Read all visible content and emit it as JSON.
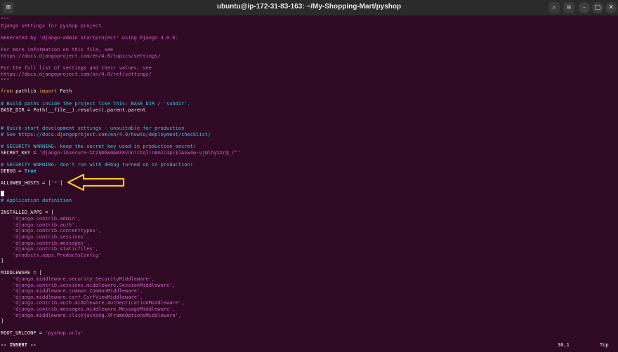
{
  "window": {
    "title": "ubuntu@ip-172-31-83-163: ~/My-Shopping-Mart/pyshop",
    "new_tab_icon": "new-tab-icon",
    "buttons": {
      "search_icon": "search-icon",
      "menu_icon": "hamburger-menu-icon",
      "minimize": "–",
      "maximize": "□",
      "close": "✕"
    }
  },
  "code": {
    "l1": "\"\"\"",
    "l2": "Django settings for pyshop project.",
    "l4": "Generated by 'django-admin startproject' using Django 4.0.6.",
    "l6": "For more information on this file, see",
    "l7": "https://docs.djangoproject.com/en/4.0/topics/settings/",
    "l9": "For the full list of settings and their values, see",
    "l10": "https://docs.djangoproject.com/en/4.0/ref/settings/",
    "l11": "\"\"\"",
    "l13_kw1": "from",
    "l13_mod": " pathlib ",
    "l13_kw2": "import",
    "l13_name": " Path",
    "l15": "# Build paths inside the project like this: BASE_DIR / 'subdir'.",
    "l16": "BASE_DIR = Path(__file__).resolve().parent.parent",
    "l19": "# Quick-start development settings - unsuitable for production",
    "l20": "# See https://docs.djangoproject.com/en/4.0/howto/deployment/checklist/",
    "l22": "# SECURITY WARNING: keep the secret key used in production secret!",
    "l23_name": "SECRET_KEY = ",
    "l23_str": "'django-insecure-%t2$m6&0&033vnn!=tql!n0mzc4p($)&vw4w-vjmlhy%2r@_r^'",
    "l25": "# SECURITY WARNING: don't run with debug turned on in production!",
    "l26_name": "DEBUG = ",
    "l26_val": "True",
    "l28_name": "ALLOWED_HOSTS = [",
    "l28_str": "'*'",
    "l28_end": "]",
    "l31": "# Application definition",
    "l33": "INSTALLED_APPS = [",
    "apps": [
      "    'django.contrib.admin',",
      "    'django.contrib.auth',",
      "    'django.contrib.contenttypes',",
      "    'django.contrib.sessions',",
      "    'django.contrib.messages',",
      "    'django.contrib.staticfiles',",
      "    'products.apps.ProductsConfig'"
    ],
    "l41": "]",
    "l43": "MIDDLEWARE = [",
    "middleware": [
      "    'django.middleware.security.SecurityMiddleware',",
      "    'django.contrib.sessions.middleware.SessionMiddleware',",
      "    'django.middleware.common.CommonMiddleware',",
      "    'django.middleware.csrf.CsrfViewMiddleware',",
      "    'django.contrib.auth.middleware.AuthenticationMiddleware',",
      "    'django.contrib.messages.middleware.MessageMiddleware',",
      "    'django.middleware.clickjacking.XFrameOptionsMiddleware',"
    ],
    "l51": "]",
    "l53_name": "ROOT_URLCONF = ",
    "l53_str": "'pyshop.urls'"
  },
  "status": {
    "mode": "-- INSERT --",
    "position": "30,1",
    "scroll": "Top"
  },
  "colors": {
    "background": "#300a24",
    "string": "#d066c4",
    "comment": "#33c7de",
    "keyword": "#e0b043",
    "arrow": "#f5c518"
  }
}
